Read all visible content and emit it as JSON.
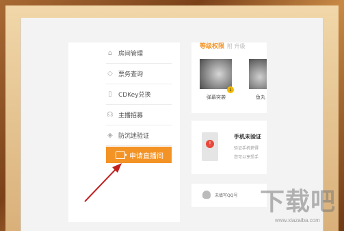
{
  "menu": {
    "items": [
      {
        "label": "房间管理",
        "icon": "home-icon"
      },
      {
        "label": "票务查询",
        "icon": "ticket-icon"
      },
      {
        "label": "CDKey兑换",
        "icon": "cdkey-icon"
      },
      {
        "label": "主播招募",
        "icon": "recruit-icon"
      },
      {
        "label": "防沉迷验证",
        "icon": "shield-icon"
      }
    ],
    "live_button": "申请直播间"
  },
  "panel_top": {
    "title": "等级权限",
    "title_suffix": "附 升级",
    "cards": [
      {
        "label": "弹幕突袭"
      },
      {
        "label": "鱼丸"
      }
    ],
    "badge": "1"
  },
  "panel_mid": {
    "title": "手机未验证",
    "line1": "验证手机获得",
    "line2": "您可以享受手"
  },
  "panel_bot": {
    "qq_text": "未填写QQ号"
  },
  "watermark": {
    "big": "下载吧",
    "url": "www.xiazaiba.com"
  }
}
